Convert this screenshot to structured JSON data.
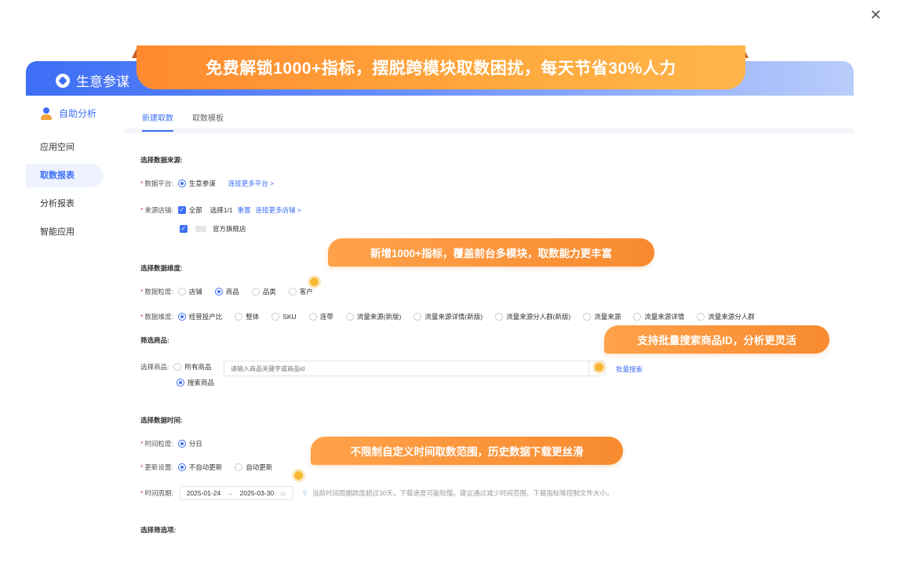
{
  "banner": "免费解锁1000+指标，摆脱跨模块取数困扰，每天节省30%人力",
  "brand": "生意参谋",
  "sidebar": {
    "header": "自助分析",
    "items": [
      {
        "label": "应用空间"
      },
      {
        "label": "取数报表"
      },
      {
        "label": "分析报表"
      },
      {
        "label": "智能应用"
      }
    ]
  },
  "tabs": [
    "新建取数",
    "取数模板"
  ],
  "form": {
    "source_title": "选择数据来源:",
    "platform_label": "数据平台:",
    "platform_value": "生意参谋",
    "platform_link": "连接更多平台 >",
    "shop_label": "来源店铺:",
    "shop_all": "全部",
    "shop_count": "选择1/1",
    "shop_reset": "重置",
    "shop_link": "连接更多店铺 >",
    "shop_name": "官方旗舰店",
    "dim_title": "选择数据维度:",
    "granularity_label": "数据粒度:",
    "granularity_opts": [
      "店铺",
      "商品",
      "品类",
      "客户"
    ],
    "dimension_label": "数据维度:",
    "dimension_opts": [
      "经营投产比",
      "整体",
      "SKU",
      "连带",
      "流量来源(新版)",
      "流量来源详情(新版)",
      "流量来源分人群(新版)",
      "流量来源",
      "流量来源详情",
      "流量来源分人群"
    ],
    "filter_title": "筛选商品:",
    "select_goods_label": "选择商品:",
    "all_goods": "所有商品",
    "search_goods": "搜索商品",
    "search_placeholder": "请输入商品关键字或商品id",
    "batch_search": "批量搜索",
    "time_title": "选择数据时间:",
    "time_gran_label": "时间粒度:",
    "time_gran_value": "分日",
    "update_label": "更新设置:",
    "update_opts": [
      "不自动更新",
      "自动更新"
    ],
    "period_label": "时间周期:",
    "date_start": "2025-01-24",
    "date_sep": "→",
    "date_end": "2025-03-30",
    "period_hint": "当前时间周期跨度超过30天，下载速度可能较慢。建议通过减少时间范围、下载指标等控制文件大小。",
    "filter_opts_title": "选择筛选项:"
  },
  "callouts": {
    "metrics": "新增1000+指标，覆盖前台多模块，取数能力更丰富",
    "batch": "支持批量搜索商品ID，分析更灵活",
    "time": "不限制自定义时间取数范围，历史数据下载更丝滑"
  },
  "colors": {
    "accent": "#3d6ef5",
    "callout": "#f88a2f",
    "required": "#e23d3d"
  }
}
